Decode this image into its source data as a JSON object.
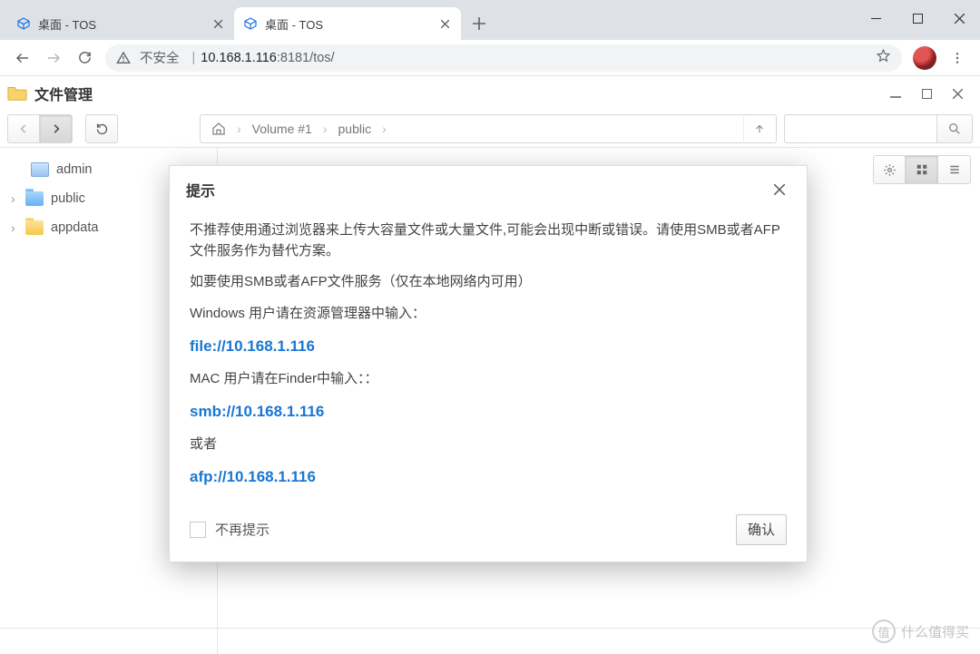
{
  "browser": {
    "tabs": [
      {
        "title": "桌面 - TOS",
        "active": false
      },
      {
        "title": "桌面 - TOS",
        "active": true
      }
    ],
    "security_label": "不安全",
    "url_host": "10.168.1.116",
    "url_port": ":8181",
    "url_path": "/tos/"
  },
  "app": {
    "title": "文件管理",
    "breadcrumb": {
      "seg1": "Volume #1",
      "seg2": "public"
    },
    "tree": {
      "item0": "admin",
      "item1": "public",
      "item2": "appdata"
    }
  },
  "modal": {
    "title": "提示",
    "para1": "不推荐使用通过浏览器来上传大容量文件或大量文件,可能会出现中断或错误。请使用SMB或者AFP文件服务作为替代方案。",
    "para2": "如要使用SMB或者AFP文件服务（仅在本地网络内可用）",
    "win_label": "Windows 用户请在资源管理器中输入：",
    "link1": "file://10.168.1.116",
    "mac_label": "MAC 用户请在Finder中输入：：",
    "link2": "smb://10.168.1.116",
    "or": "或者",
    "link3": "afp://10.168.1.116",
    "dont_show": "不再提示",
    "ok": "确认"
  },
  "watermark": {
    "badge": "值",
    "text": "什么值得买"
  }
}
